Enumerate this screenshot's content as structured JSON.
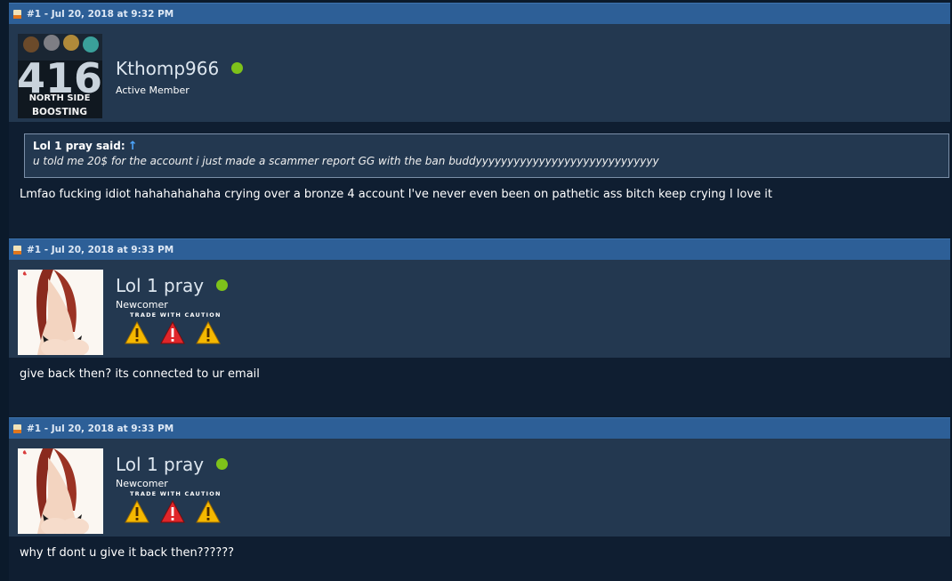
{
  "posts": [
    {
      "header": "#1 - Jul 20, 2018 at 9:32 PM",
      "username": "Kthomp966",
      "user_title": "Active Member",
      "avatar_text_top": "416",
      "avatar_text_mid": "NORTH SIDE",
      "avatar_text_bottom": "BOOSTING",
      "quote": {
        "author": "Lol 1 pray said:",
        "arrow": "↑",
        "text": "u told me 20$ for the account i just made a scammer report GG with the ban buddyyyyyyyyyyyyyyyyyyyyyyyyyyyyy"
      },
      "message": "Lmfao fucking idiot hahahahahaha crying over a bronze 4 account I've never even been on pathetic ass bitch keep crying I love it"
    },
    {
      "header": "#1 - Jul 20, 2018 at 9:33 PM",
      "username": "Lol 1 pray",
      "user_title": "Newcomer",
      "caution_label": "TRADE WITH CAUTION",
      "message": "give back then? its connected to ur email"
    },
    {
      "header": "#1 - Jul 20, 2018 at 9:33 PM",
      "username": "Lol 1 pray",
      "user_title": "Newcomer",
      "caution_label": "TRADE WITH CAUTION",
      "message": "why tf dont u give it back then??????"
    }
  ],
  "colors": {
    "header_bar": "#2d5f97",
    "user_block": "#233850",
    "body_bg": "#0f1e31",
    "online": "#7ec21a",
    "warn_yellow": "#f5b800",
    "warn_red": "#e0262a"
  },
  "icons": [
    "post-icon",
    "online-dot",
    "warning-triangle-icon"
  ]
}
